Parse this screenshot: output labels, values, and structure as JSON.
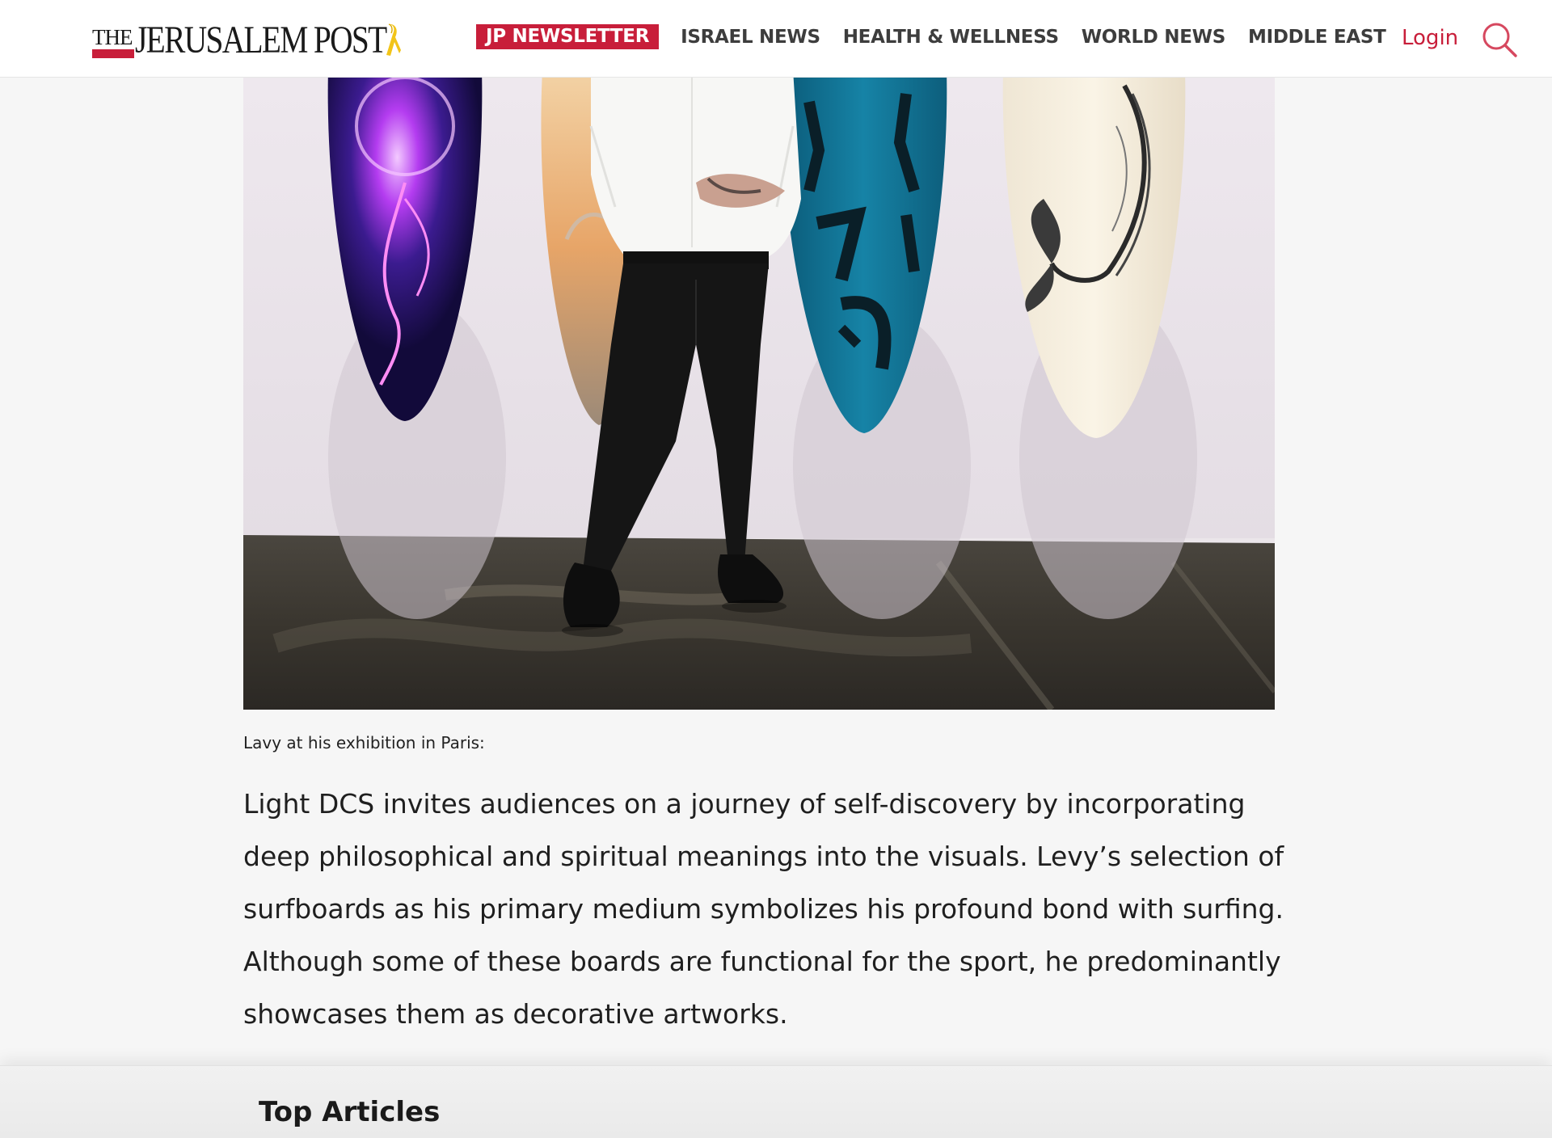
{
  "header": {
    "logo_text_the": "THE",
    "logo_text_main": "JERUSALEM POST",
    "nav": [
      {
        "label": "JP NEWSLETTER"
      },
      {
        "label": "ISRAEL NEWS"
      },
      {
        "label": "HEALTH & WELLNESS"
      },
      {
        "label": "WORLD NEWS"
      },
      {
        "label": "MIDDLE EAST"
      }
    ],
    "login_label": "Login",
    "search_icon": "search-icon"
  },
  "article": {
    "photo_icon": "exhibition-photo",
    "caption": "Lavy at his exhibition in Paris:",
    "body": "Light DCS invites audiences on a journey of self-discovery by incorporating deep philosophical and spiritual meanings into the visuals. Levy’s selection of surfboards as his primary medium symbolizes his profound bond with surfing. Although some of these boards are functional for the sport, he predominantly showcases them as decorative artworks."
  },
  "top_articles": {
    "title": "Top Articles"
  },
  "colors": {
    "brand_red": "#c81e3a",
    "nav_text": "#3d3d3d",
    "page_bg": "#f6f6f6"
  }
}
